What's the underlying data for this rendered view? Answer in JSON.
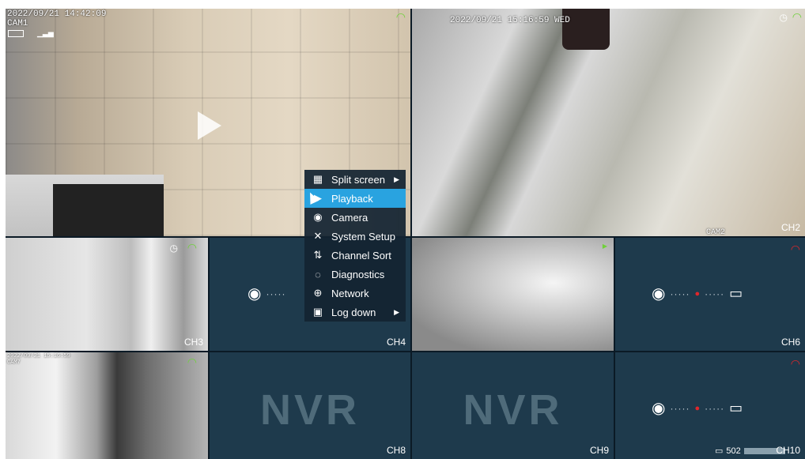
{
  "tiles": {
    "t1": {
      "timestamp": "2022/09/21 14:42:09",
      "camera": "CAM1"
    },
    "t2": {
      "timestamp": "2022/09/21 15:16:59 WED",
      "camera": "CAM2",
      "channel": "CH2"
    },
    "t3": {
      "channel": "CH3"
    },
    "t4": {
      "channel": "CH4"
    },
    "t6": {
      "channel": "CH6"
    },
    "t7": {
      "timestamp": "2022/09/21 15:16:59",
      "camera": "CAM7"
    },
    "t8": {
      "nvr_text": "NVR",
      "channel": "CH8"
    },
    "t9": {
      "nvr_text": "NVR",
      "channel": "CH9"
    },
    "t10": {
      "device": "502",
      "channel": "CH10"
    }
  },
  "context_menu": {
    "items": [
      {
        "label": "Split screen",
        "icon": "grid-icon",
        "submenu": true
      },
      {
        "label": "Playback",
        "icon": "playback-icon",
        "selected": true
      },
      {
        "label": "Camera",
        "icon": "camera-icon"
      },
      {
        "label": "System Setup",
        "icon": "tools-icon"
      },
      {
        "label": "Channel Sort",
        "icon": "sort-icon"
      },
      {
        "label": "Diagnostics",
        "icon": "diagnostics-icon"
      },
      {
        "label": "Network",
        "icon": "globe-icon"
      },
      {
        "label": "Log down",
        "icon": "logout-icon",
        "submenu": true
      }
    ]
  },
  "colors": {
    "navy": "#1e3a4c",
    "selected": "#29a3e0",
    "wifi_green": "#6fd13a",
    "status_red": "#e0262b"
  }
}
